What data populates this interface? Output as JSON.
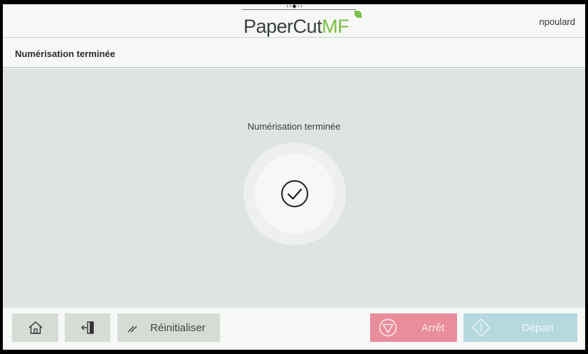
{
  "header": {
    "logo_main": "PaperCut",
    "logo_accent": "MF",
    "username": "npoulard"
  },
  "title_bar": {
    "title": "Numérisation terminée"
  },
  "main": {
    "status_message": "Numérisation terminée",
    "status_icon": "check-circle-icon"
  },
  "footer": {
    "home_icon": "home-icon",
    "logout_icon": "logout-icon",
    "reset_label": "Réinitialiser",
    "stop_label": "Arrêt",
    "start_label": "Départ"
  },
  "colors": {
    "brand_green": "#7bbf46",
    "stop_button": "#e98d9d",
    "start_button": "#b6d8df",
    "neutral_button": "#d6dbd6",
    "content_background": "#e0e4e0"
  }
}
